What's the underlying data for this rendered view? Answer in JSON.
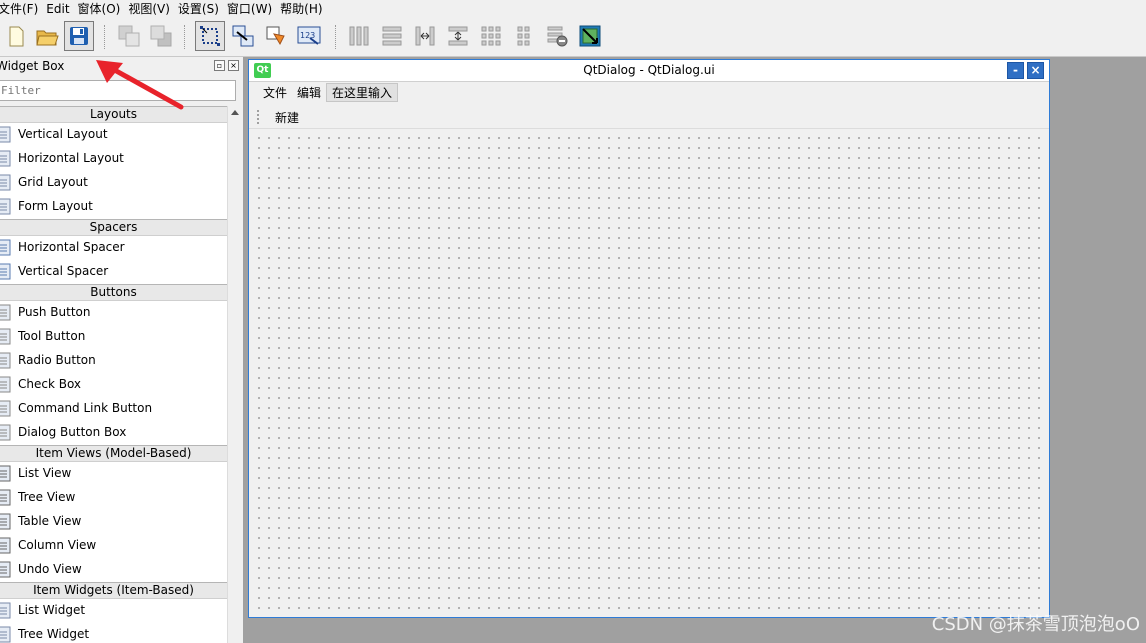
{
  "menubar": {
    "items": [
      {
        "label": "文件(F)"
      },
      {
        "label": "Edit"
      },
      {
        "label": "窗体(O)"
      },
      {
        "label": "视图(V)"
      },
      {
        "label": "设置(S)"
      },
      {
        "label": "窗口(W)"
      },
      {
        "label": "帮助(H)"
      }
    ]
  },
  "toolbar": {
    "buttons": [
      {
        "icon": "new-file-icon"
      },
      {
        "icon": "open-folder-icon"
      },
      {
        "icon": "save-icon",
        "active": true
      },
      {
        "icon": "send-to-back-icon"
      },
      {
        "icon": "bring-to-front-icon"
      },
      {
        "icon": "edit-widgets-icon",
        "active": true
      },
      {
        "icon": "edit-signals-slots-icon"
      },
      {
        "icon": "edit-buddies-icon"
      },
      {
        "icon": "edit-tab-order-icon"
      },
      {
        "icon": "layout-horizontal-icon"
      },
      {
        "icon": "layout-vertical-icon"
      },
      {
        "icon": "layout-horizontal-splitter-icon"
      },
      {
        "icon": "layout-vertical-splitter-icon"
      },
      {
        "icon": "layout-grid-icon"
      },
      {
        "icon": "layout-form-icon"
      },
      {
        "icon": "break-layout-icon"
      },
      {
        "icon": "adjust-size-icon"
      }
    ]
  },
  "widget_box": {
    "title": "Widget Box",
    "filter_placeholder": "Filter",
    "categories": [
      {
        "name": "Layouts",
        "items": [
          "Vertical Layout",
          "Horizontal Layout",
          "Grid Layout",
          "Form Layout"
        ]
      },
      {
        "name": "Spacers",
        "items": [
          "Horizontal Spacer",
          "Vertical Spacer"
        ]
      },
      {
        "name": "Buttons",
        "items": [
          "Push Button",
          "Tool Button",
          "Radio Button",
          "Check Box",
          "Command Link Button",
          "Dialog Button Box"
        ]
      },
      {
        "name": "Item Views (Model-Based)",
        "items": [
          "List View",
          "Tree View",
          "Table View",
          "Column View",
          "Undo View"
        ]
      },
      {
        "name": "Item Widgets (Item-Based)",
        "items": [
          "List Widget",
          "Tree Widget"
        ]
      }
    ]
  },
  "dialog": {
    "qt_badge": "Qt",
    "title": "QtDialog - QtDialog.ui",
    "minimize_label": "-",
    "close_label": "×",
    "menus": [
      "文件",
      "编辑",
      "在这里输入"
    ],
    "toolbar_actions": [
      "新建"
    ]
  },
  "watermark": "CSDN @抹茶雪顶泡泡oO",
  "colors": {
    "accent": "#2e7bd6",
    "arrow": "#e8232b",
    "qt_green": "#41cd52"
  }
}
